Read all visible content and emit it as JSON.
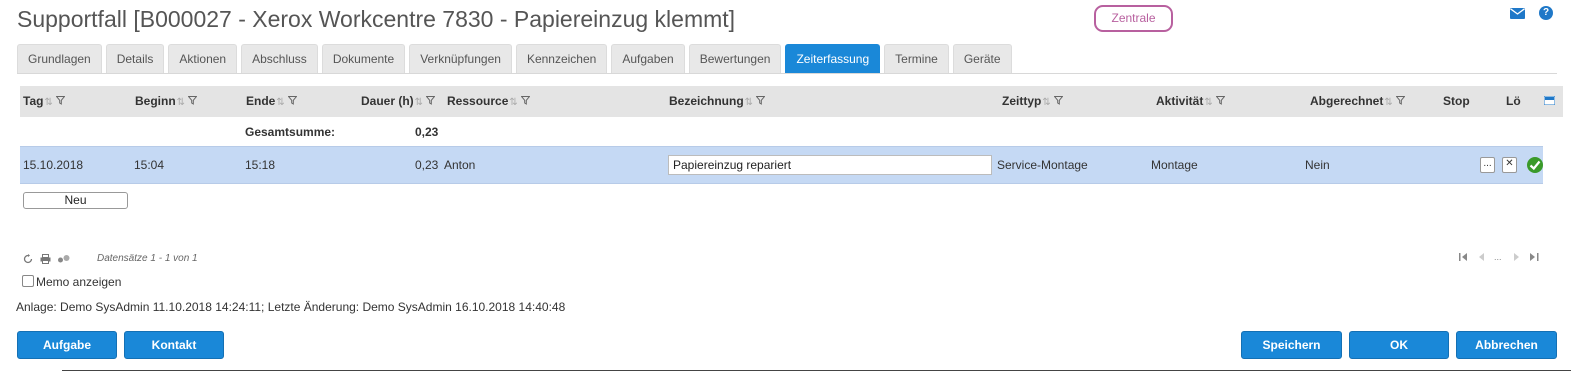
{
  "header": {
    "title": "Supportfall [B000027 - Xerox Workcentre 7830 - Papiereinzug klemmt]",
    "badge": "Zentrale",
    "help_label": "?"
  },
  "tabs": [
    {
      "label": "Grundlagen"
    },
    {
      "label": "Details"
    },
    {
      "label": "Aktionen"
    },
    {
      "label": "Abschluss"
    },
    {
      "label": "Dokumente"
    },
    {
      "label": "Verknüpfungen"
    },
    {
      "label": "Kennzeichen"
    },
    {
      "label": "Aufgaben"
    },
    {
      "label": "Bewertungen"
    },
    {
      "label": "Zeiterfassung",
      "active": true
    },
    {
      "label": "Termine"
    },
    {
      "label": "Geräte"
    }
  ],
  "grid": {
    "columns": {
      "tag": "Tag",
      "beginn": "Beginn",
      "ende": "Ende",
      "dauer": "Dauer (h)",
      "ressource": "Ressource",
      "bezeichnung": "Bezeichnung",
      "zeittyp": "Zeittyp",
      "aktivitaet": "Aktivität",
      "abgerechnet": "Abgerechnet",
      "stop": "Stop",
      "loeschen": "Lö"
    },
    "total_label": "Gesamtsumme:",
    "total_value": "0,23",
    "rows": [
      {
        "tag": "15.10.2018",
        "beginn": "15:04",
        "ende": "15:18",
        "dauer": "0,23",
        "ressource": "Anton",
        "bezeichnung": "Papiereinzug repariert",
        "zeittyp": "Service-Montage",
        "aktivitaet": "Montage",
        "abgerechnet": "Nein",
        "more_label": "...",
        "close_label": "✕"
      }
    ],
    "new_button": "Neu",
    "records_info": "Datensätze 1 - 1 von 1",
    "pager_ellipsis": "..."
  },
  "memo_label": "Memo anzeigen",
  "meta_line": "Anlage: Demo SysAdmin 11.10.2018 14:24:11; Letzte Änderung: Demo SysAdmin 16.10.2018 14:40:48",
  "buttons": {
    "aufgabe": "Aufgabe",
    "kontakt": "Kontakt",
    "speichern": "Speichern",
    "ok": "OK",
    "abbrechen": "Abbrechen"
  },
  "colors": {
    "accent": "#1a88d8",
    "badge": "#b8609f",
    "row_selected": "#c5d9f4"
  }
}
